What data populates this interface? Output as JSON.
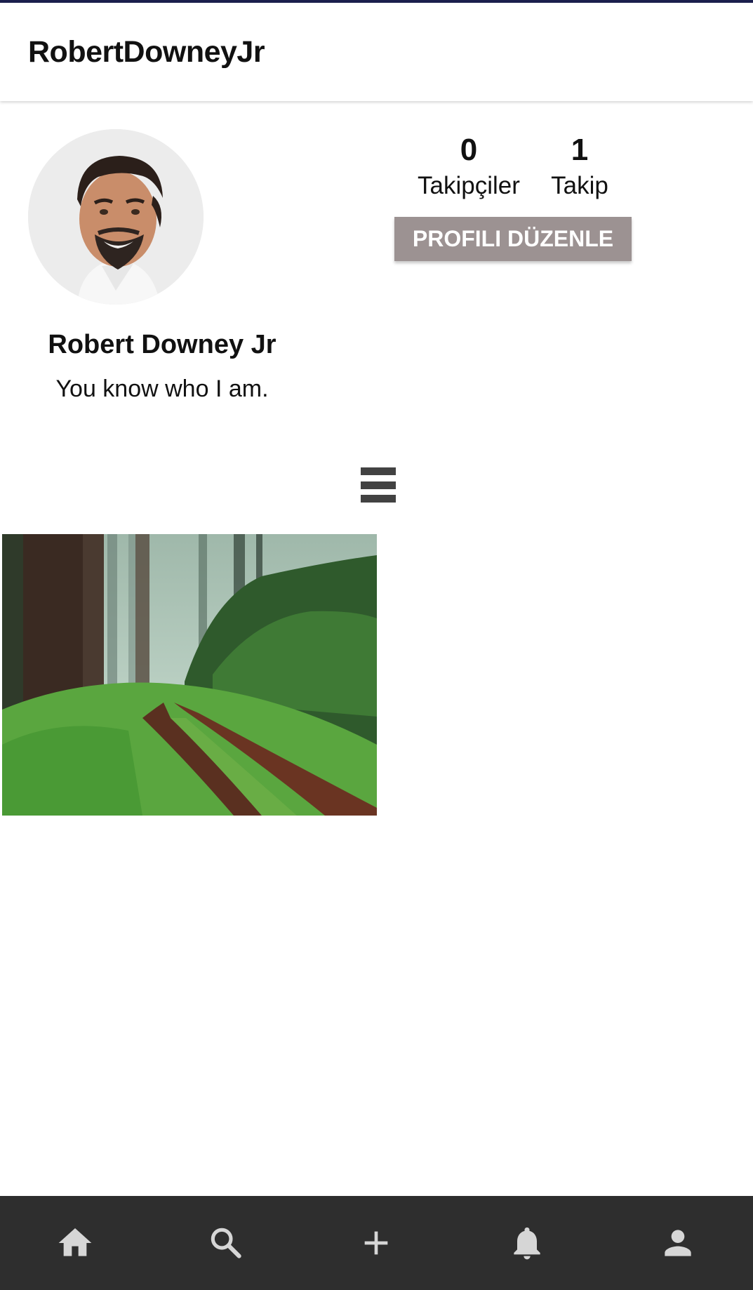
{
  "app_bar": {
    "title": "RobertDowneyJr"
  },
  "profile": {
    "display_name": "Robert Downey Jr",
    "bio": "You know who I am.",
    "avatar_icon": "profile-photo"
  },
  "stats": {
    "followers": {
      "count": "0",
      "label": "Takipçiler"
    },
    "following": {
      "count": "1",
      "label": "Takip"
    }
  },
  "edit_profile_button": {
    "label": "PROFILI DÜZENLE"
  },
  "view_toggle": {
    "icon": "list-view-icon"
  },
  "posts": [
    {
      "icon": "forest-path-photo"
    }
  ],
  "bottom_nav": {
    "items": [
      {
        "icon": "home-icon"
      },
      {
        "icon": "search-icon"
      },
      {
        "icon": "add-icon"
      },
      {
        "icon": "notifications-icon"
      },
      {
        "icon": "profile-icon"
      }
    ]
  },
  "colors": {
    "top_line": "#1b1f4d",
    "edit_button": "#9c9292",
    "bottom_nav_bg": "#2e2e2e",
    "nav_icon": "#d6d6d6"
  }
}
